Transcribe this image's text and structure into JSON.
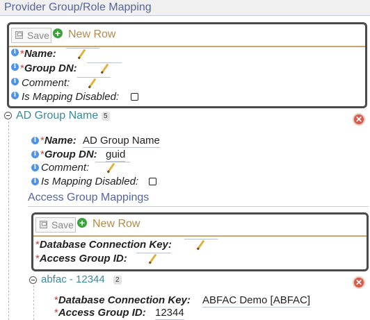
{
  "header": {
    "title": "Provider Group/Role Mapping"
  },
  "new_row_form": {
    "save_label": "Save",
    "new_row_label": "New Row",
    "fields": {
      "name": "Name:",
      "group_dn": "Group DN:",
      "comment": "Comment:",
      "mapping_disabled": "Is Mapping Disabled:"
    },
    "required_mark": "*"
  },
  "group": {
    "title": "AD Group Name",
    "count": "5",
    "name_label": "Name:",
    "name_value": "AD Group Name",
    "group_dn_label": "Group DN:",
    "group_dn_value": "guid",
    "comment_label": "Comment:",
    "mapping_disabled_label": "Is Mapping Disabled:"
  },
  "access_section": {
    "title": "Access Group Mappings",
    "save_label": "Save",
    "new_row_label": "New Row",
    "db_key_label": "Database Connection Key:",
    "access_id_label": "Access Group ID:"
  },
  "sub_group": {
    "title": "abfac - 12344",
    "count": "2",
    "db_key_label": "Database Connection Key:",
    "db_key_value": "ABFAC Demo [ABFAC]",
    "access_id_label": "Access Group ID:",
    "access_id_value": "12344"
  },
  "colors": {
    "header_text": "#56649e",
    "group_link": "#3a8a9a",
    "new_row": "#b28b4c",
    "required": "#d23a3a"
  }
}
